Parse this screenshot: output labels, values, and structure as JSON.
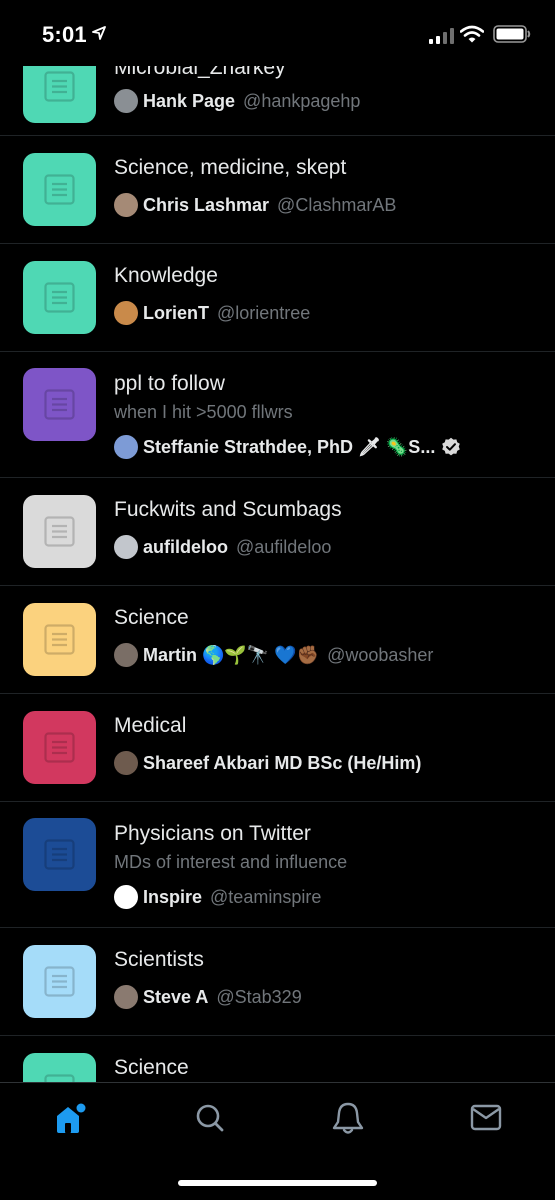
{
  "status_bar": {
    "time": "5:01"
  },
  "lists": [
    {
      "title": "Microbial_Zharkey",
      "description": "",
      "owner_name": "Hank Page",
      "owner_handle": "@hankpagehp",
      "color": "#4fd8b4",
      "avatar_color": "#8a8f94"
    },
    {
      "title": "Science, medicine, skept",
      "description": "",
      "owner_name": "Chris Lashmar",
      "owner_handle": "@ClashmarAB",
      "color": "#4fd8b4",
      "avatar_color": "#a58a76"
    },
    {
      "title": "Knowledge",
      "description": "",
      "owner_name": "LorienT",
      "owner_handle": "@lorientree",
      "color": "#4fd8b4",
      "avatar_color": "#c98a4a"
    },
    {
      "title": "ppl to follow",
      "description": "when I hit >5000 fllwrs",
      "owner_name": "Steffanie Strathdee, PhD 🗡 🦠S...",
      "owner_handle": "",
      "verified": true,
      "color": "#7e55c7",
      "avatar_color": "#7d9bd6"
    },
    {
      "title": "Fuckwits and Scumbags",
      "description": "",
      "owner_name": "aufildeloo",
      "owner_handle": "@aufildeloo",
      "color": "#dadada",
      "avatar_color": "#c2c6cc"
    },
    {
      "title": "Science",
      "description": "",
      "owner_name": "Martin 🌎🌱🔭 💙✊🏾",
      "owner_handle": "@woobasher",
      "color": "#fbd27e",
      "avatar_color": "#7a6e66"
    },
    {
      "title": "Medical",
      "description": "",
      "owner_name": "Shareef Akbari MD BSc (He/Him)",
      "owner_handle": "",
      "color": "#d2385f",
      "avatar_color": "#6e5b4e"
    },
    {
      "title": "Physicians on Twitter",
      "description": "MDs of interest and influence",
      "owner_name": "Inspire",
      "owner_handle": "@teaminspire",
      "color": "#1c4c96",
      "avatar_color": "#ffffff"
    },
    {
      "title": "Scientists",
      "description": "",
      "owner_name": "Steve A",
      "owner_handle": "@Stab329",
      "color": "#a5dcf9",
      "avatar_color": "#8a7a70"
    },
    {
      "title": "Science",
      "description": "",
      "owner_name": "",
      "owner_handle": "",
      "color": "#4fd8b4",
      "avatar_color": "#000000"
    }
  ],
  "tab_bar": {
    "accent_color": "#1d9bf0",
    "icons": [
      "home-icon",
      "search-icon",
      "notifications-icon",
      "messages-icon"
    ]
  }
}
